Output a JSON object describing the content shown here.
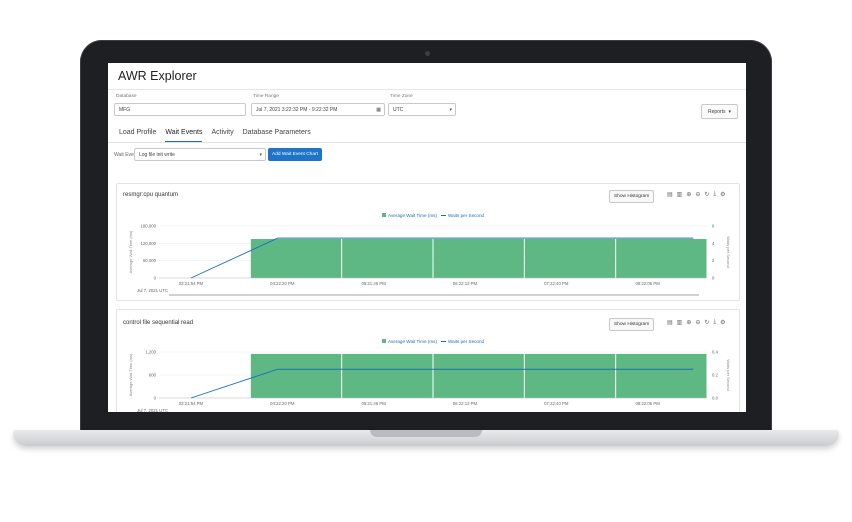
{
  "app": {
    "title": "AWR Explorer"
  },
  "filters": {
    "database": {
      "label": "Database",
      "value": "MFG"
    },
    "time_range": {
      "label": "Time Range",
      "value": "Jul 7, 2021 3:22:32 PM - 9:22:32 PM"
    },
    "time_zone": {
      "label": "Time Zone",
      "value": "UTC"
    },
    "reports_label": "Reports"
  },
  "tabs": [
    "Load Profile",
    "Wait Events",
    "Activity",
    "Database Parameters"
  ],
  "active_tab": "Wait Events",
  "wait_event": {
    "label": "Wait Event",
    "value": "Log file init write",
    "add_button": "Add Wait Event Chart"
  },
  "legend": {
    "bar_series": "Average Wait Time (ms)",
    "line_series": "Waits per Second"
  },
  "colors": {
    "bar": "#5db884",
    "line": "#1a6fba",
    "accent": "#1f74c7"
  },
  "icons": [
    "document-icon",
    "bar-chart-icon",
    "zoom-in-icon",
    "zoom-out-icon",
    "reset-icon",
    "download-icon",
    "settings-icon"
  ],
  "panels": [
    {
      "title": "resmgr:cpu quantum",
      "show_histogram_label": "Show Histogram",
      "y_left_label": "Average Wait Time (ms)",
      "y_right_label": "Waits per Second",
      "x_date_label": "Jul 7, 2021 UTC",
      "chart_data": {
        "type": "bar",
        "x": [
          "03:21:54 PM",
          "04:22:20 PM",
          "05:21:46 PM",
          "06:22:13 PM",
          "07:22:40 PM",
          "08:22:06 PM"
        ],
        "y_left_ticks": [
          "180,000",
          "120,000",
          "60,000",
          "0"
        ],
        "y_right_ticks": [
          "6",
          "4",
          "2",
          "0"
        ],
        "series": [
          {
            "name": "Average Wait Time (ms)",
            "type": "bar",
            "values": [
              0,
              135000,
              135000,
              135000,
              135000,
              135000
            ]
          },
          {
            "name": "Waits per Second",
            "type": "line",
            "values": [
              0,
              4.6,
              4.6,
              4.6,
              4.6,
              4.6
            ]
          }
        ],
        "ylim_left": [
          0,
          180000
        ],
        "ylim_right": [
          0,
          6
        ]
      }
    },
    {
      "title": "control file sequential read",
      "show_histogram_label": "Show Histogram",
      "y_left_label": "Average Wait Time (ms)",
      "y_right_label": "Waits per Second",
      "x_date_label": "Jul 7, 2021 UTC",
      "chart_data": {
        "type": "bar",
        "x": [
          "03:21:54 PM",
          "04:22:20 PM",
          "05:21:46 PM",
          "06:22:13 PM",
          "07:22:40 PM",
          "08:22:06 PM"
        ],
        "y_left_ticks": [
          "1,200",
          "600",
          "0"
        ],
        "y_right_ticks": [
          "0.4",
          "0.2",
          "0.0"
        ],
        "series": [
          {
            "name": "Average Wait Time (ms)",
            "type": "bar",
            "values": [
              0,
              1150,
              1150,
              1150,
              1150,
              1150
            ]
          },
          {
            "name": "Waits per Second",
            "type": "line",
            "values": [
              0,
              0.25,
              0.25,
              0.25,
              0.25,
              0.25
            ]
          }
        ],
        "ylim_left": [
          0,
          1200
        ],
        "ylim_right": [
          0,
          0.4
        ]
      }
    }
  ]
}
